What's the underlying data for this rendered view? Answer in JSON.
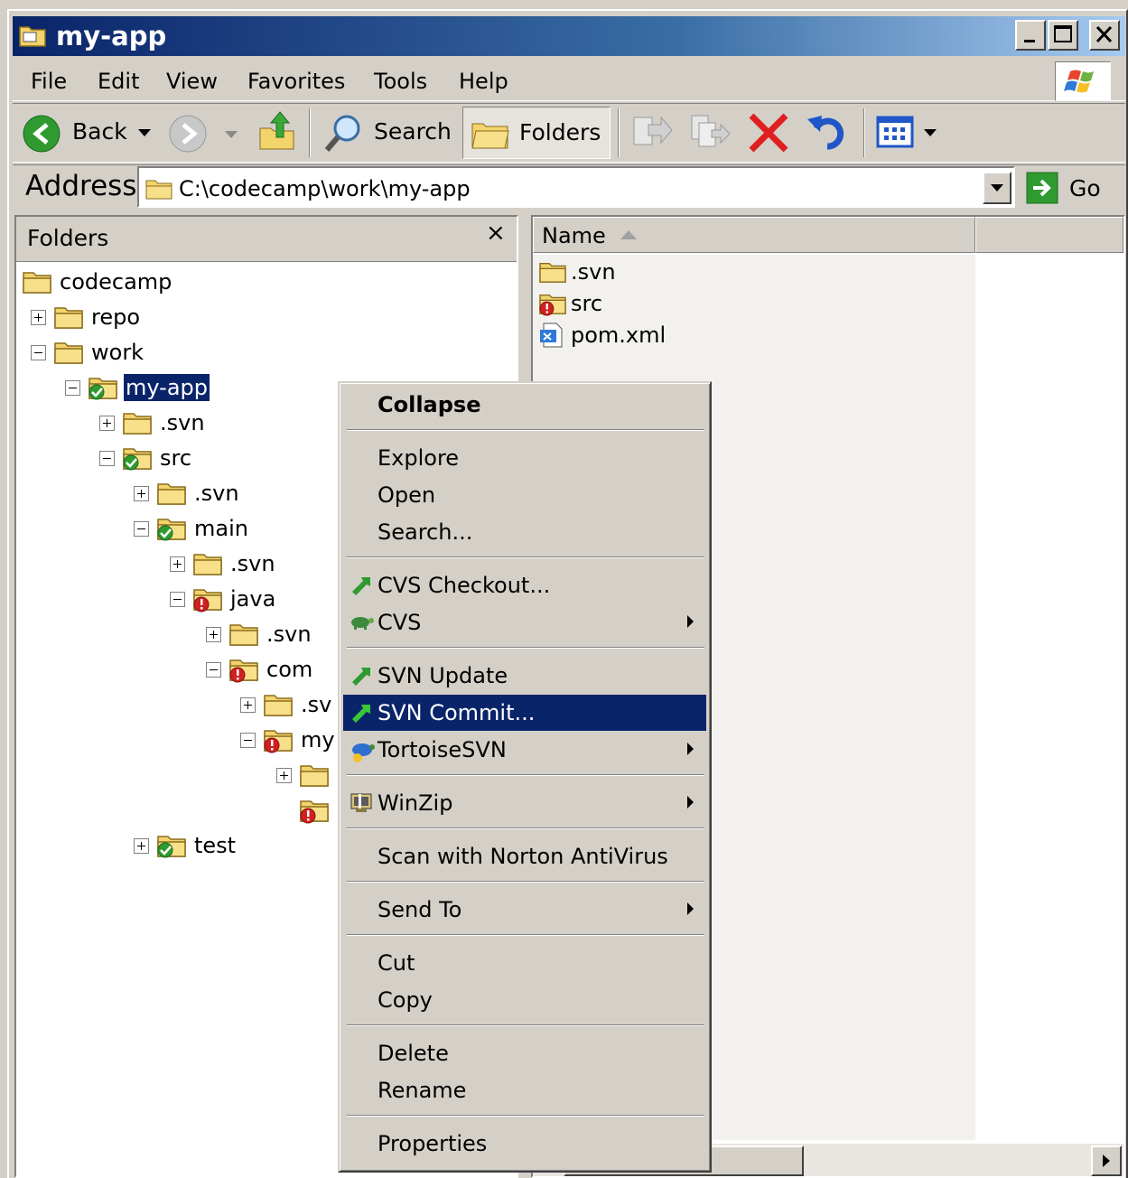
{
  "window": {
    "title": "my-app"
  },
  "menu": {
    "items": [
      "File",
      "Edit",
      "View",
      "Favorites",
      "Tools",
      "Help"
    ]
  },
  "toolbar": {
    "back": "Back",
    "search": "Search",
    "folders": "Folders"
  },
  "address": {
    "label": "Address",
    "value": "C:\\codecamp\\work\\my-app",
    "go": "Go"
  },
  "folders_pane": {
    "title": "Folders",
    "close": "×",
    "nodes": [
      {
        "label": "codecamp",
        "expander": "none",
        "icon": "folder-icon"
      },
      {
        "label": "repo",
        "expander": "plus",
        "icon": "folder-icon"
      },
      {
        "label": "work",
        "expander": "minus",
        "icon": "folder-icon"
      },
      {
        "label": "my-app",
        "expander": "minus",
        "icon": "svn-ok-folder-icon",
        "selected": true
      },
      {
        "label": ".svn",
        "expander": "plus",
        "icon": "folder-icon"
      },
      {
        "label": "src",
        "expander": "minus",
        "icon": "svn-ok-folder-icon"
      },
      {
        "label": ".svn",
        "expander": "plus",
        "icon": "folder-icon"
      },
      {
        "label": "main",
        "expander": "minus",
        "icon": "svn-ok-folder-icon"
      },
      {
        "label": ".svn",
        "expander": "plus",
        "icon": "folder-icon"
      },
      {
        "label": "java",
        "expander": "minus",
        "icon": "svn-modified-folder-icon"
      },
      {
        "label": ".svn",
        "expander": "plus",
        "icon": "folder-icon"
      },
      {
        "label": "com",
        "expander": "minus",
        "icon": "svn-modified-folder-icon"
      },
      {
        "label": ".sv",
        "expander": "plus",
        "icon": "folder-icon"
      },
      {
        "label": "my",
        "expander": "minus",
        "icon": "svn-modified-folder-icon"
      },
      {
        "label": "",
        "expander": "plus",
        "icon": "folder-icon"
      },
      {
        "label": "",
        "expander": "none",
        "icon": "svn-modified-folder-icon"
      },
      {
        "label": "test",
        "expander": "plus",
        "icon": "svn-ok-folder-icon"
      }
    ]
  },
  "files_pane": {
    "column_name": "Name",
    "files": [
      {
        "name": ".svn",
        "icon": "folder-icon"
      },
      {
        "name": "src",
        "icon": "svn-modified-folder-icon"
      },
      {
        "name": "pom.xml",
        "icon": "xml-file-icon"
      }
    ]
  },
  "context_menu": {
    "items": [
      {
        "label": "Collapse",
        "bold": true
      },
      {
        "sep": true
      },
      {
        "label": "Explore"
      },
      {
        "label": "Open"
      },
      {
        "label": "Search..."
      },
      {
        "sep": true
      },
      {
        "label": "CVS Checkout...",
        "icon": "cvs-checkout-icon"
      },
      {
        "label": "CVS",
        "icon": "turtle-icon",
        "submenu": true
      },
      {
        "sep": true
      },
      {
        "label": "SVN Update",
        "icon": "svn-update-icon"
      },
      {
        "label": "SVN Commit...",
        "icon": "svn-commit-icon",
        "highlighted": true
      },
      {
        "label": "TortoiseSVN",
        "icon": "tortoise-icon",
        "submenu": true
      },
      {
        "sep": true
      },
      {
        "label": "WinZip",
        "icon": "winzip-icon",
        "submenu": true
      },
      {
        "sep": true
      },
      {
        "label": "Scan with Norton AntiVirus"
      },
      {
        "sep": true
      },
      {
        "label": "Send To",
        "submenu": true
      },
      {
        "sep": true
      },
      {
        "label": "Cut"
      },
      {
        "label": "Copy"
      },
      {
        "sep": true
      },
      {
        "label": "Delete"
      },
      {
        "label": "Rename"
      },
      {
        "sep": true
      },
      {
        "label": "Properties"
      }
    ]
  },
  "colors": {
    "title_start": "#0a246a",
    "title_end": "#a6caf0",
    "selection": "#0a246a",
    "chrome": "#d4d0c8",
    "delete_red": "#e02020"
  }
}
